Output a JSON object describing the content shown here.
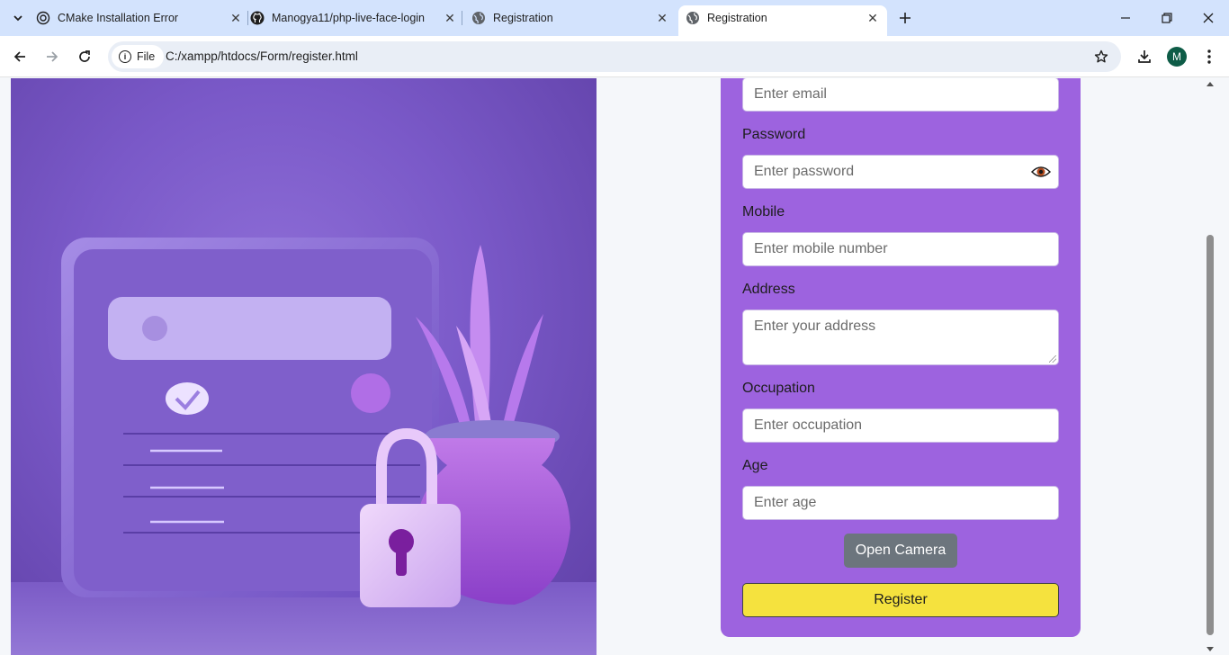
{
  "browser": {
    "tabs": [
      {
        "title": "CMake Installation Error",
        "icon": "chatgpt-icon",
        "active": false
      },
      {
        "title": "Manogya11/php-live-face-login",
        "icon": "github-icon",
        "active": false
      },
      {
        "title": "Registration",
        "icon": "globe-icon",
        "active": false
      },
      {
        "title": "Registration",
        "icon": "globe-icon",
        "active": true
      }
    ],
    "address": {
      "scheme_label": "File",
      "url": "C:/xampp/htdocs/Form/register.html"
    },
    "profile_initial": "M"
  },
  "form": {
    "email": {
      "placeholder": "Enter email"
    },
    "password": {
      "label": "Password",
      "placeholder": "Enter password"
    },
    "mobile": {
      "label": "Mobile",
      "placeholder": "Enter mobile number"
    },
    "address": {
      "label": "Address",
      "placeholder": "Enter your address"
    },
    "occupation": {
      "label": "Occupation",
      "placeholder": "Enter occupation"
    },
    "age": {
      "label": "Age",
      "placeholder": "Enter age"
    },
    "camera_button": "Open Camera",
    "register_button": "Register"
  },
  "colors": {
    "card": "#9d63df",
    "register_button": "#f5e23e",
    "camera_button": "#6c757d",
    "tab_strip": "#d3e3fd"
  }
}
